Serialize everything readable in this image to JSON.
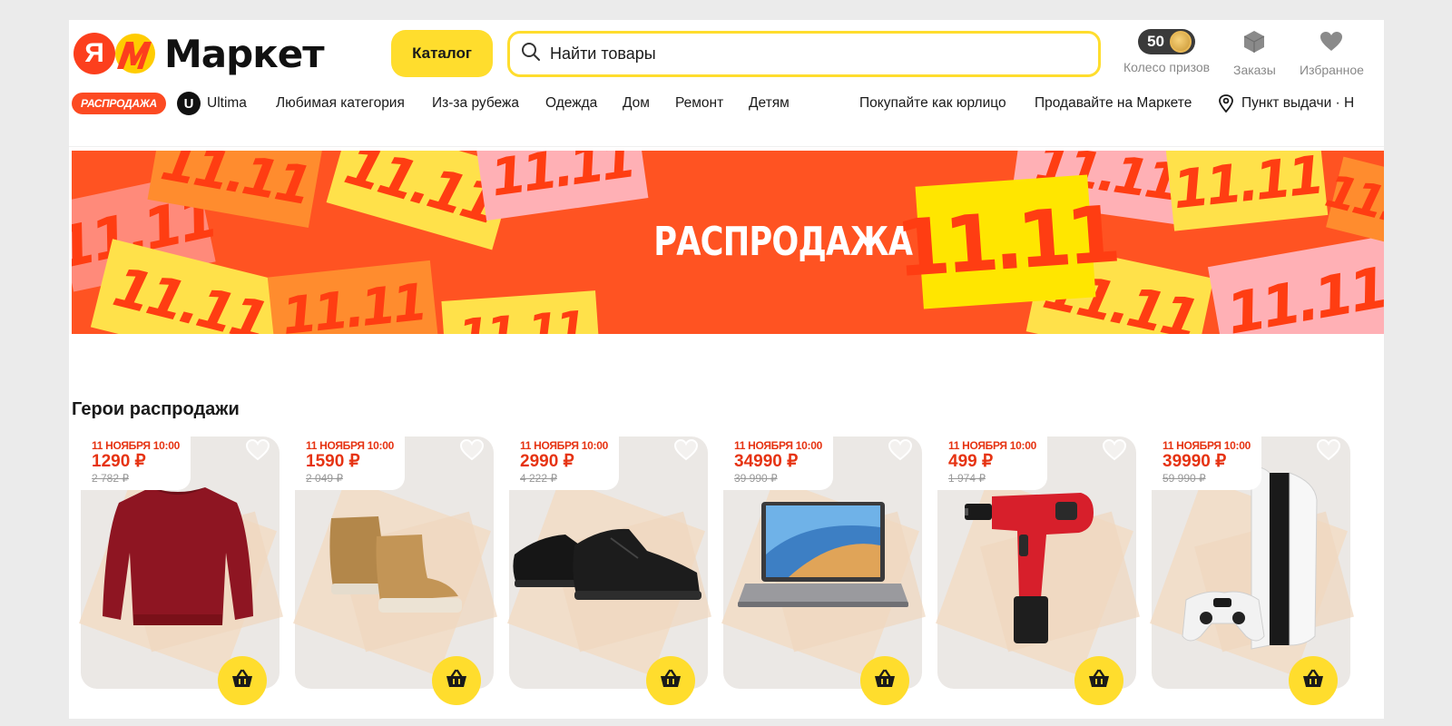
{
  "header": {
    "logo_ya": "Я",
    "logo_word": "Маркет",
    "catalog_label": "Каталог",
    "search_placeholder": "Найти товары",
    "coins_count": "50",
    "prize_wheel_label": "Колесо призов",
    "orders_label": "Заказы",
    "favorites_label": "Избранное"
  },
  "nav": {
    "sale_label": "РАСПРОДАЖА",
    "ultima_label": "Ultima",
    "items": [
      "Любимая категория",
      "Из-за рубежа",
      "Одежда",
      "Дом",
      "Ремонт",
      "Детям"
    ],
    "business_label": "Покупайте как юрлицо",
    "sell_label": "Продавайте на Маркете",
    "pickup_label": "Пункт выдачи · Н"
  },
  "banner": {
    "text": "РАСПРОДАЖА",
    "number": "11.11",
    "tile_text": "11.11"
  },
  "section": {
    "title": "Герои распродажи"
  },
  "products": [
    {
      "date": "11 НОЯБРЯ 10:00",
      "price": "1290 ₽",
      "old_price": "2 782 ₽",
      "item": "sweatshirt"
    },
    {
      "date": "11 НОЯБРЯ 10:00",
      "price": "1590 ₽",
      "old_price": "2 049 ₽",
      "item": "boots"
    },
    {
      "date": "11 НОЯБРЯ 10:00",
      "price": "2990 ₽",
      "old_price": "4 222 ₽",
      "item": "sneakers"
    },
    {
      "date": "11 НОЯБРЯ 10:00",
      "price": "34990 ₽",
      "old_price": "39 990 ₽",
      "item": "laptop"
    },
    {
      "date": "11 НОЯБРЯ 10:00",
      "price": "499 ₽",
      "old_price": "1 974 ₽",
      "item": "drill"
    },
    {
      "date": "11 НОЯБРЯ 10:00",
      "price": "39990 ₽",
      "old_price": "59 990 ₽",
      "item": "game-console"
    }
  ],
  "colors": {
    "brand_yellow": "#ffdd2d",
    "brand_red": "#fc3f1d",
    "banner_orange": "#ff5322",
    "price_red": "#e63312"
  }
}
